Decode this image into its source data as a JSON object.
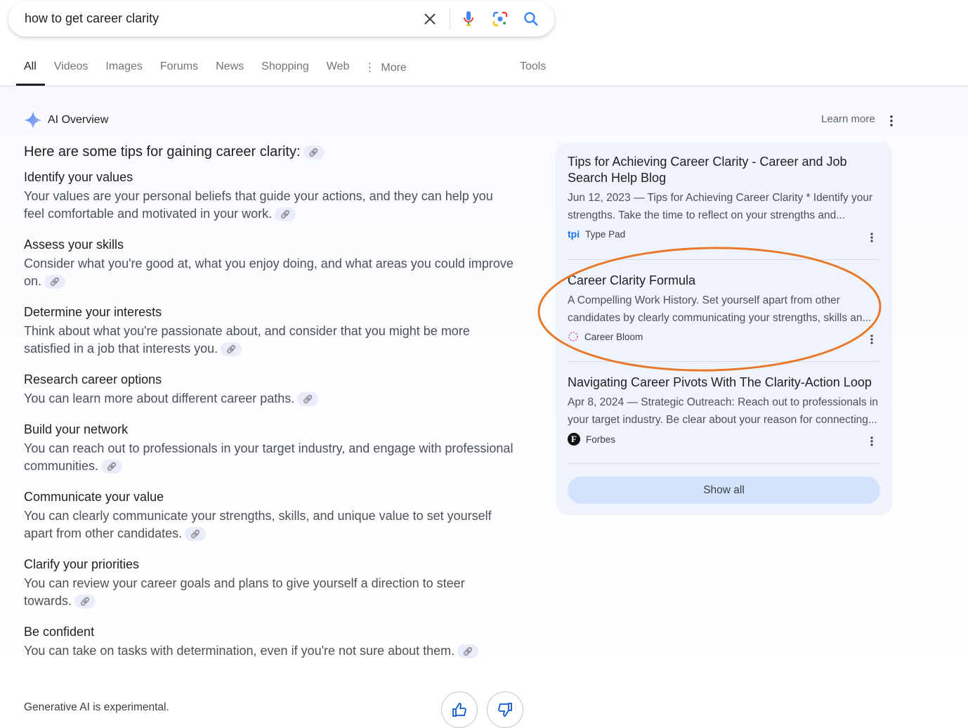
{
  "search": {
    "query": "how to get career clarity"
  },
  "tabs": [
    {
      "label": "All"
    },
    {
      "label": "Videos"
    },
    {
      "label": "Images"
    },
    {
      "label": "Forums"
    },
    {
      "label": "News"
    },
    {
      "label": "Shopping"
    },
    {
      "label": "Web"
    },
    {
      "label": "More"
    }
  ],
  "tools_label": "Tools",
  "ai": {
    "title": "AI Overview",
    "learn_more": "Learn more",
    "intro": "Here are some tips for gaining career clarity:",
    "sections": [
      {
        "heading": "Identify your values",
        "body": "Your values are your personal beliefs that guide your actions, and they can help you feel comfortable and motivated in your work."
      },
      {
        "heading": "Assess your skills",
        "body": "Consider what you're good at, what you enjoy doing, and what areas you could improve on."
      },
      {
        "heading": "Determine your interests",
        "body": "Think about what you're passionate about, and consider that you might be more satisfied in a job that interests you."
      },
      {
        "heading": "Research career options",
        "body": "You can learn more about different career paths."
      },
      {
        "heading": "Build your network",
        "body": "You can reach out to professionals in your target industry, and engage with professional communities."
      },
      {
        "heading": "Communicate your value",
        "body": "You can clearly communicate your strengths, skills, and unique value to set yourself apart from other candidates."
      },
      {
        "heading": "Clarify your priorities",
        "body": "You can review your career goals and plans to give yourself a direction to steer towards."
      },
      {
        "heading": "Be confident",
        "body": "You can take on tasks with determination, even if you're not sure about them."
      }
    ],
    "footer": "Generative AI is experimental."
  },
  "sources": [
    {
      "title": "Tips for Achieving Career Clarity - Career and Job Search Help Blog",
      "snippet1": "Jun 12, 2023 — Tips for Achieving Career Clarity * Identify your",
      "snippet2": "strengths. Take the time to reflect on your strengths and...",
      "site": "Type Pad",
      "logo": "tpi"
    },
    {
      "title": "Career Clarity Formula",
      "snippet1": "A Compelling Work History. Set yourself apart from other",
      "snippet2": "candidates by clearly communicating your strengths, skills an...",
      "site": "Career Bloom"
    },
    {
      "title": "Navigating Career Pivots With The Clarity-Action Loop",
      "snippet1": "Apr 8, 2024 — Strategic Outreach: Reach out to professionals in",
      "snippet2": "your target industry. Be clear about your reason for connecting...",
      "site": "Forbes",
      "logo": "F"
    }
  ],
  "show_all": "Show all",
  "colors": {
    "annotation": "#e8792b",
    "accent": "#1a73e8",
    "show_all_bg": "#d3e3fd"
  }
}
